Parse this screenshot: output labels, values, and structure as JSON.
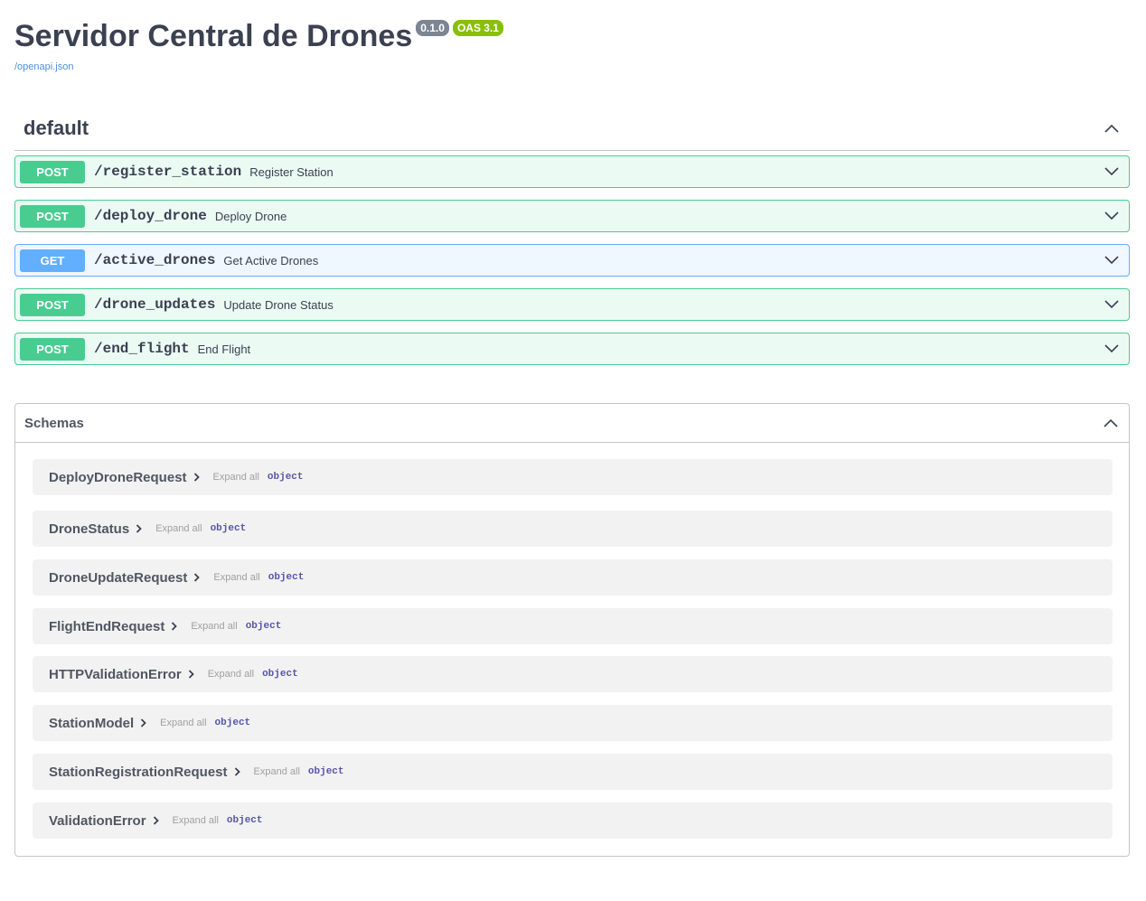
{
  "info": {
    "title": "Servidor Central de Drones",
    "version": "0.1.0",
    "oas": "OAS 3.1",
    "spec_link": "/openapi.json"
  },
  "tag": {
    "name": "default",
    "operations": [
      {
        "method": "POST",
        "path": "/register_station",
        "summary": "Register Station"
      },
      {
        "method": "POST",
        "path": "/deploy_drone",
        "summary": "Deploy Drone"
      },
      {
        "method": "GET",
        "path": "/active_drones",
        "summary": "Get Active Drones"
      },
      {
        "method": "POST",
        "path": "/drone_updates",
        "summary": "Update Drone Status"
      },
      {
        "method": "POST",
        "path": "/end_flight",
        "summary": "End Flight"
      }
    ]
  },
  "schemas": {
    "title": "Schemas",
    "expand_label": "Expand all",
    "models": [
      {
        "name": "DeployDroneRequest",
        "type": "object"
      },
      {
        "name": "DroneStatus",
        "type": "object"
      },
      {
        "name": "DroneUpdateRequest",
        "type": "object"
      },
      {
        "name": "FlightEndRequest",
        "type": "object"
      },
      {
        "name": "HTTPValidationError",
        "type": "object"
      },
      {
        "name": "StationModel",
        "type": "object"
      },
      {
        "name": "StationRegistrationRequest",
        "type": "object"
      },
      {
        "name": "ValidationError",
        "type": "object"
      }
    ]
  },
  "colors": {
    "post": "#49cc90",
    "get": "#61affe",
    "version_badge": "#7d8492",
    "oas_badge": "#89bf04",
    "link": "#4990e2"
  },
  "icons": {
    "collapse": "chevron-up-icon",
    "expand": "chevron-down-icon",
    "model_toggle": "chevron-right-icon"
  }
}
